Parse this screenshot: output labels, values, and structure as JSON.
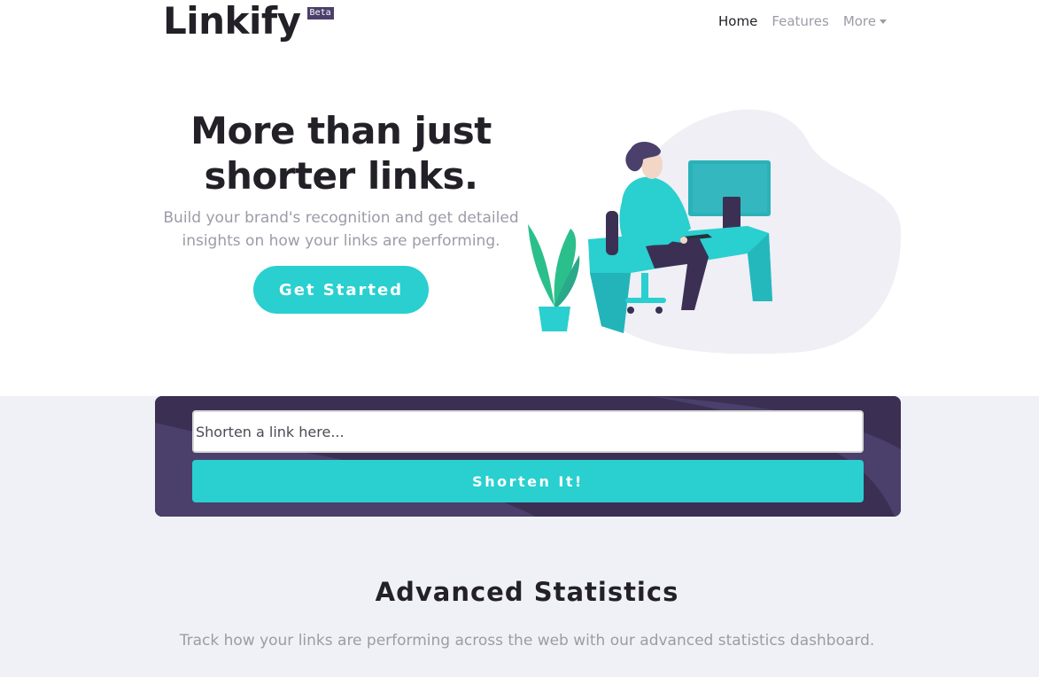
{
  "brand": {
    "name": "Linkify",
    "badge": "Beta"
  },
  "nav": {
    "home": "Home",
    "features": "Features",
    "more": "More"
  },
  "hero": {
    "title_line1": "More than just",
    "title_line2": "shorter links.",
    "subtitle": "Build your brand's recognition and get detailed insights on how your links are performing.",
    "cta": "Get Started"
  },
  "shortener": {
    "placeholder": "Shorten a link here...",
    "button": "Shorten It!"
  },
  "stats": {
    "title": "Advanced Statistics",
    "subtitle": "Track how your links are performing across the web with our advanced statistics dashboard."
  },
  "colors": {
    "accent": "#2acfcf",
    "dark_violet": "#3b3054",
    "text_dark": "#232127",
    "text_gray": "#9e9aa7",
    "bg_light": "#f0f1f6"
  }
}
